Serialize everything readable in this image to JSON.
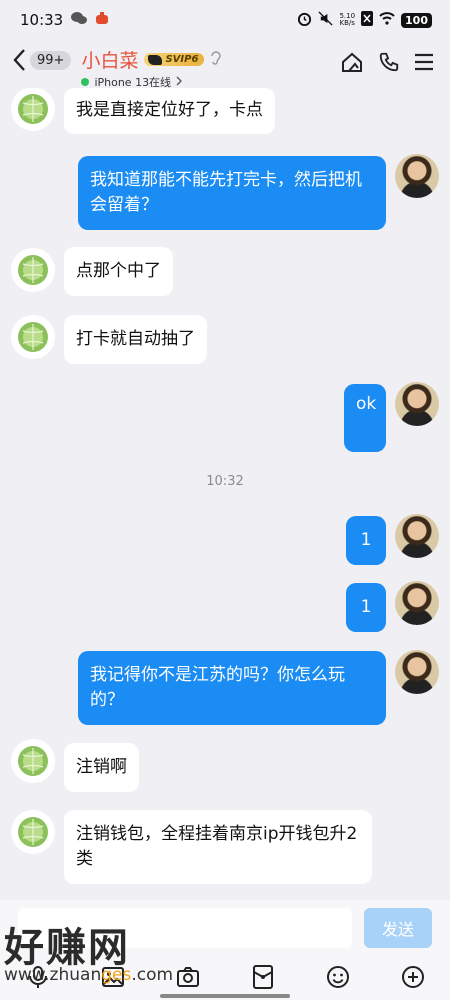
{
  "status_bar": {
    "time": "10:33",
    "net_speed_top": "5.10",
    "net_speed_bottom": "KB/s",
    "battery": "100"
  },
  "header": {
    "unread_count": "99+",
    "contact_name": "小白菜",
    "vip_label": "SVIP6",
    "device_status": "iPhone 13在线"
  },
  "messages": [
    {
      "dir": "in",
      "text": "我是直接定位好了，卡点"
    },
    {
      "dir": "out",
      "text": "我知道那能不能先打完卡，然后把机会留着？"
    },
    {
      "dir": "in",
      "text": "点那个中了"
    },
    {
      "dir": "in",
      "text": "打卡就自动抽了"
    },
    {
      "dir": "out",
      "text": "ok"
    },
    {
      "dir": "out",
      "text": "1"
    },
    {
      "dir": "out",
      "text": "1"
    },
    {
      "dir": "out",
      "text": "我记得你不是江苏的吗？你怎么玩的？"
    },
    {
      "dir": "in",
      "text": "注销啊"
    },
    {
      "dir": "in",
      "text": "注销钱包，全程挂着南京ip开钱包升2类"
    }
  ],
  "time_separator": "10:32",
  "input": {
    "placeholder": "",
    "send_label": "发送"
  },
  "watermark": {
    "big": "好赚网",
    "small_a": "www.zhuan",
    "small_b": "ges",
    "small_c": ".com"
  },
  "colors": {
    "outgoing_bubble": "#1a8cf3",
    "incoming_bubble": "#ffffff",
    "name": "#e8523c",
    "background": "#efeff4"
  }
}
